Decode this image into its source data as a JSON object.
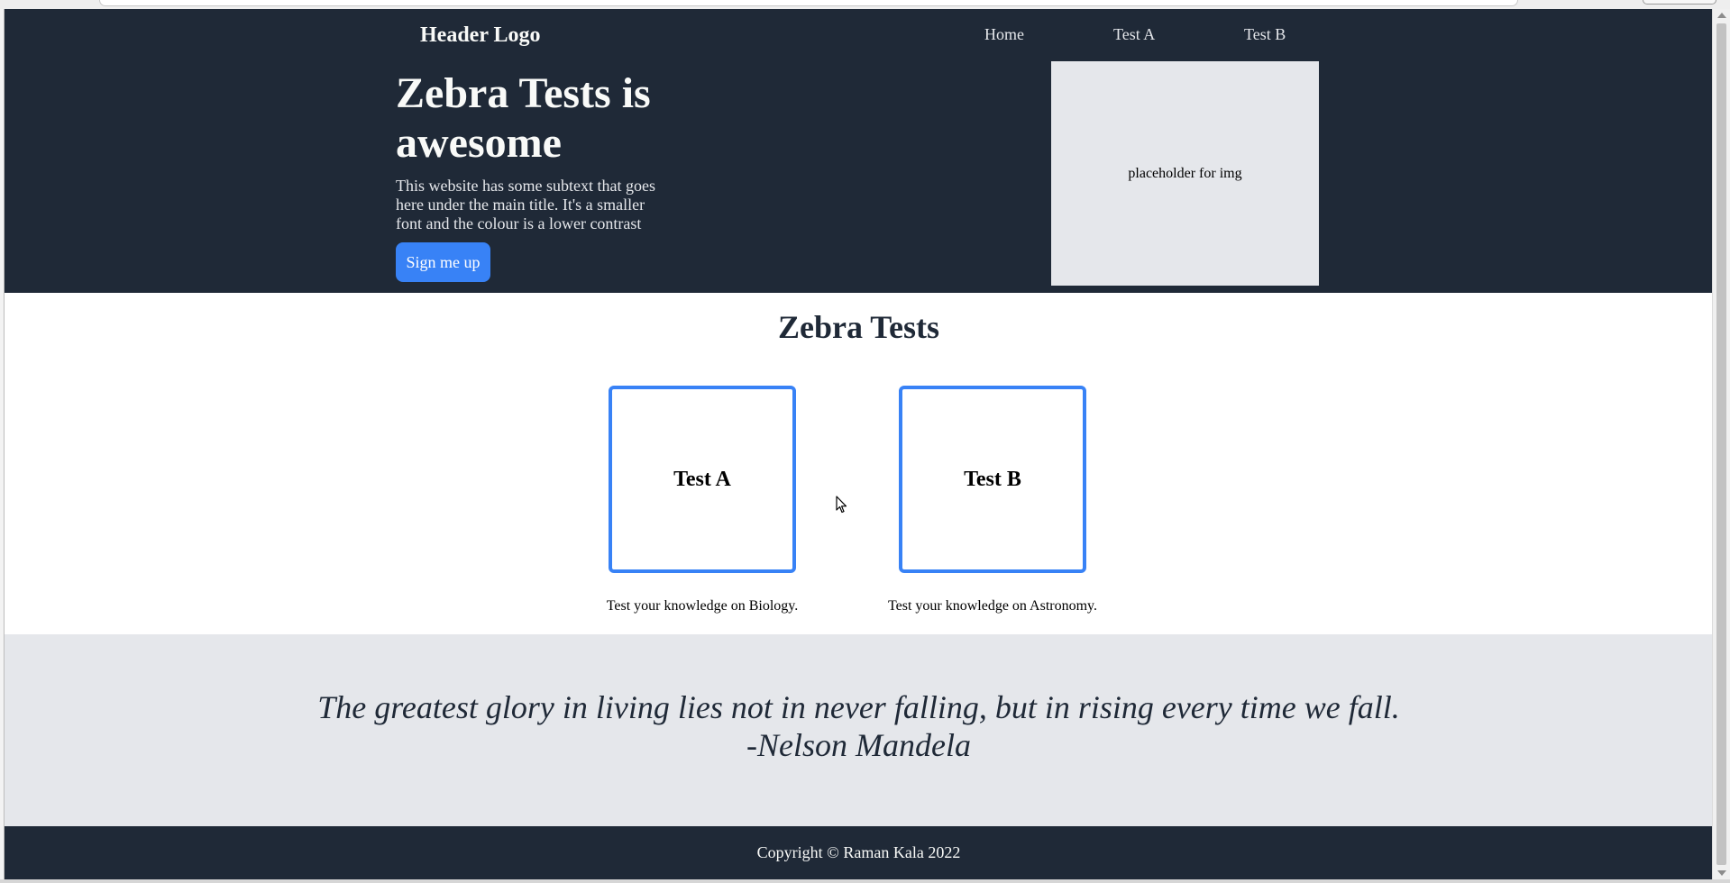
{
  "header": {
    "logo": "Header Logo",
    "nav": [
      "Home",
      "Test A",
      "Test B"
    ]
  },
  "hero": {
    "title": "Zebra Tests is awesome",
    "subtext": "This website has some subtext that goes here under the main title. It's a smaller font and the colour is a lower contrast",
    "cta_label": "Sign me up",
    "image_placeholder": "placeholder for img"
  },
  "tests": {
    "title": "Zebra Tests",
    "cards": [
      {
        "label": "Test A",
        "caption": "Test your knowledge on Biology."
      },
      {
        "label": "Test B",
        "caption": "Test your knowledge on Astronomy."
      }
    ]
  },
  "quote": {
    "text": "The greatest glory in living lies not in never falling, but in rising every time we fall.",
    "author": "-Nelson Mandela"
  },
  "footer": {
    "copyright": "Copyright © Raman Kala 2022"
  },
  "colors": {
    "header_bg": "#1f2937",
    "accent": "#3882f6",
    "light_bg": "#e5e7eb",
    "text_light": "#f9faf8"
  },
  "icons": {
    "cursor": "mouse-pointer-icon"
  }
}
